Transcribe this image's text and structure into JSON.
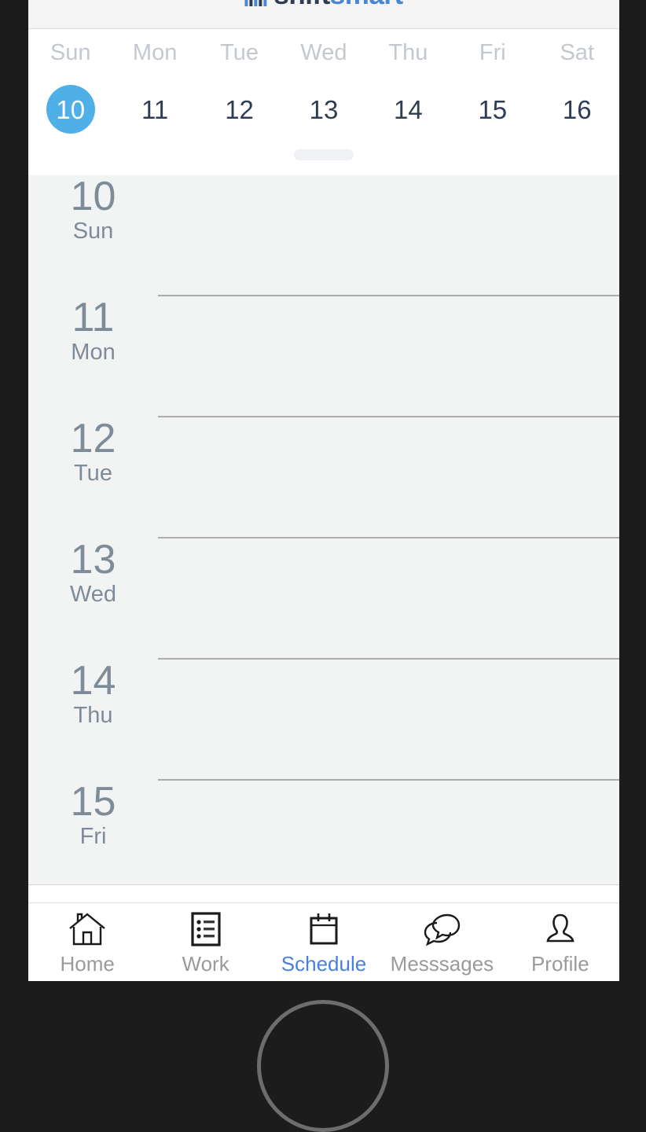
{
  "header": {
    "logo_icon": "bar-chart-logo-icon",
    "logo_text_primary": "shift",
    "logo_text_secondary": "smart"
  },
  "week_strip": {
    "days": [
      {
        "name": "Sun",
        "date": "10",
        "selected": true
      },
      {
        "name": "Mon",
        "date": "11",
        "selected": false
      },
      {
        "name": "Tue",
        "date": "12",
        "selected": false
      },
      {
        "name": "Wed",
        "date": "13",
        "selected": false
      },
      {
        "name": "Thu",
        "date": "14",
        "selected": false
      },
      {
        "name": "Fri",
        "date": "15",
        "selected": false
      },
      {
        "name": "Sat",
        "date": "16",
        "selected": false
      }
    ],
    "selected_accent_color": "#4fb0e8",
    "drag_handle": "sheet-drag-handle"
  },
  "agenda": {
    "rows": [
      {
        "date": "10",
        "weekday": "Sun",
        "events": []
      },
      {
        "date": "11",
        "weekday": "Mon",
        "events": []
      },
      {
        "date": "12",
        "weekday": "Tue",
        "events": []
      },
      {
        "date": "13",
        "weekday": "Wed",
        "events": []
      },
      {
        "date": "14",
        "weekday": "Thu",
        "events": []
      },
      {
        "date": "15",
        "weekday": "Fri",
        "events": []
      }
    ]
  },
  "bottom_nav": {
    "active_color": "#4a7fe0",
    "inactive_color": "#9a9a9a",
    "items": [
      {
        "label": "Home",
        "icon": "home-icon",
        "active": false
      },
      {
        "label": "Work",
        "icon": "list-icon",
        "active": false
      },
      {
        "label": "Schedule",
        "icon": "calendar-icon",
        "active": true
      },
      {
        "label": "Messsages",
        "icon": "chat-bubbles-icon",
        "active": false
      },
      {
        "label": "Profile",
        "icon": "person-icon",
        "active": false
      }
    ]
  }
}
